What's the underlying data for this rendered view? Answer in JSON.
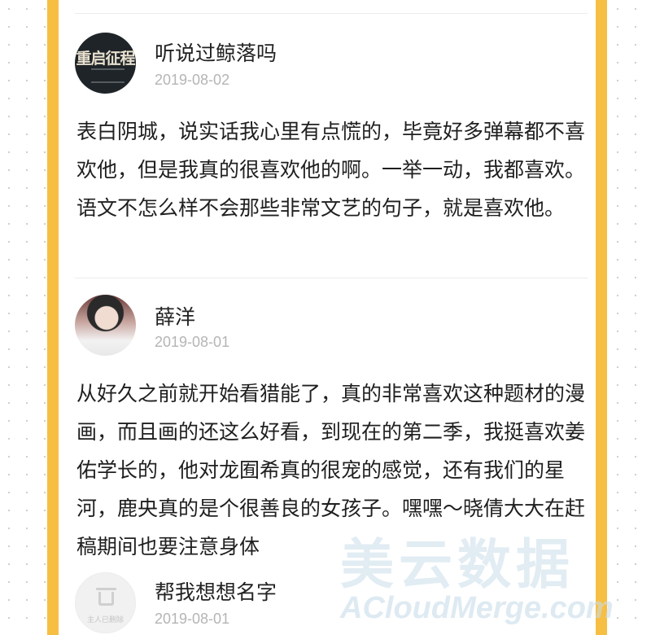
{
  "comments": [
    {
      "username": "听说过鲸落吗",
      "date": "2019-08-02",
      "avatar": {
        "type": "cover-logo",
        "logo_text": "重启征程"
      },
      "text": "表白阴城，说实话我心里有点慌的，毕竟好多弹幕都不喜欢他，但是我真的很喜欢他的啊。一举一动，我都喜欢。语文不怎么样不会那些非常文艺的句子，就是喜欢他。"
    },
    {
      "username": "薛洋",
      "date": "2019-08-01",
      "avatar": {
        "type": "photo"
      },
      "text": "从好久之前就开始看猎能了，真的非常喜欢这种题材的漫画，而且画的还这么好看，到现在的第二季，我挺喜欢姜佑学长的，他对龙囿希真的很宠的感觉，还有我们的星河，鹿央真的是个很善良的女孩子。嘿嘿～晓倩大大在赶稿期间也要注意身体"
    },
    {
      "username": "帮我想想名字",
      "date": "2019-08-01",
      "avatar": {
        "type": "deleted",
        "icon": "trash-icon",
        "label": "主人已删除"
      }
    }
  ],
  "watermark": {
    "cn": "美云数据",
    "en": "ACloudMerge.com"
  },
  "colors": {
    "border": "#f6bf44",
    "date": "#b5b5b5",
    "text": "#1f1f1f"
  }
}
